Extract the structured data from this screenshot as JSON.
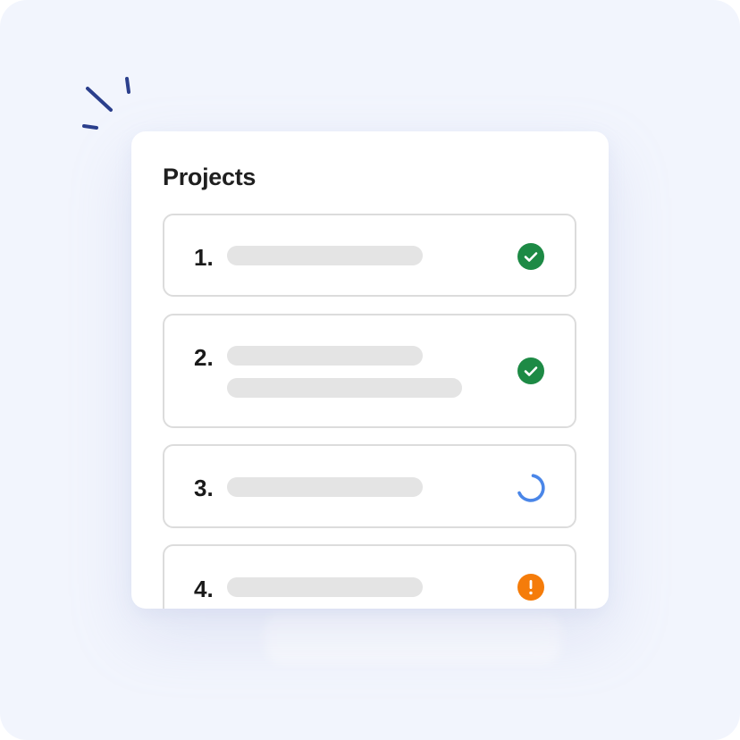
{
  "projects": {
    "title": "Projects",
    "items": [
      {
        "number": "1.",
        "status": "done",
        "status_icon": "check-circle-icon"
      },
      {
        "number": "2.",
        "status": "done",
        "status_icon": "check-circle-icon"
      },
      {
        "number": "3.",
        "status": "in-progress",
        "status_icon": "loading-spinner-icon"
      },
      {
        "number": "4.",
        "status": "warning",
        "status_icon": "alert-circle-icon"
      }
    ]
  },
  "colors": {
    "background": "#f2f5fd",
    "done": "#1d8a45",
    "in_progress": "#4a86e8",
    "warning": "#f57c0a",
    "sparkle": "#2b3f8c",
    "placeholder_bar": "#e4e4e4"
  }
}
